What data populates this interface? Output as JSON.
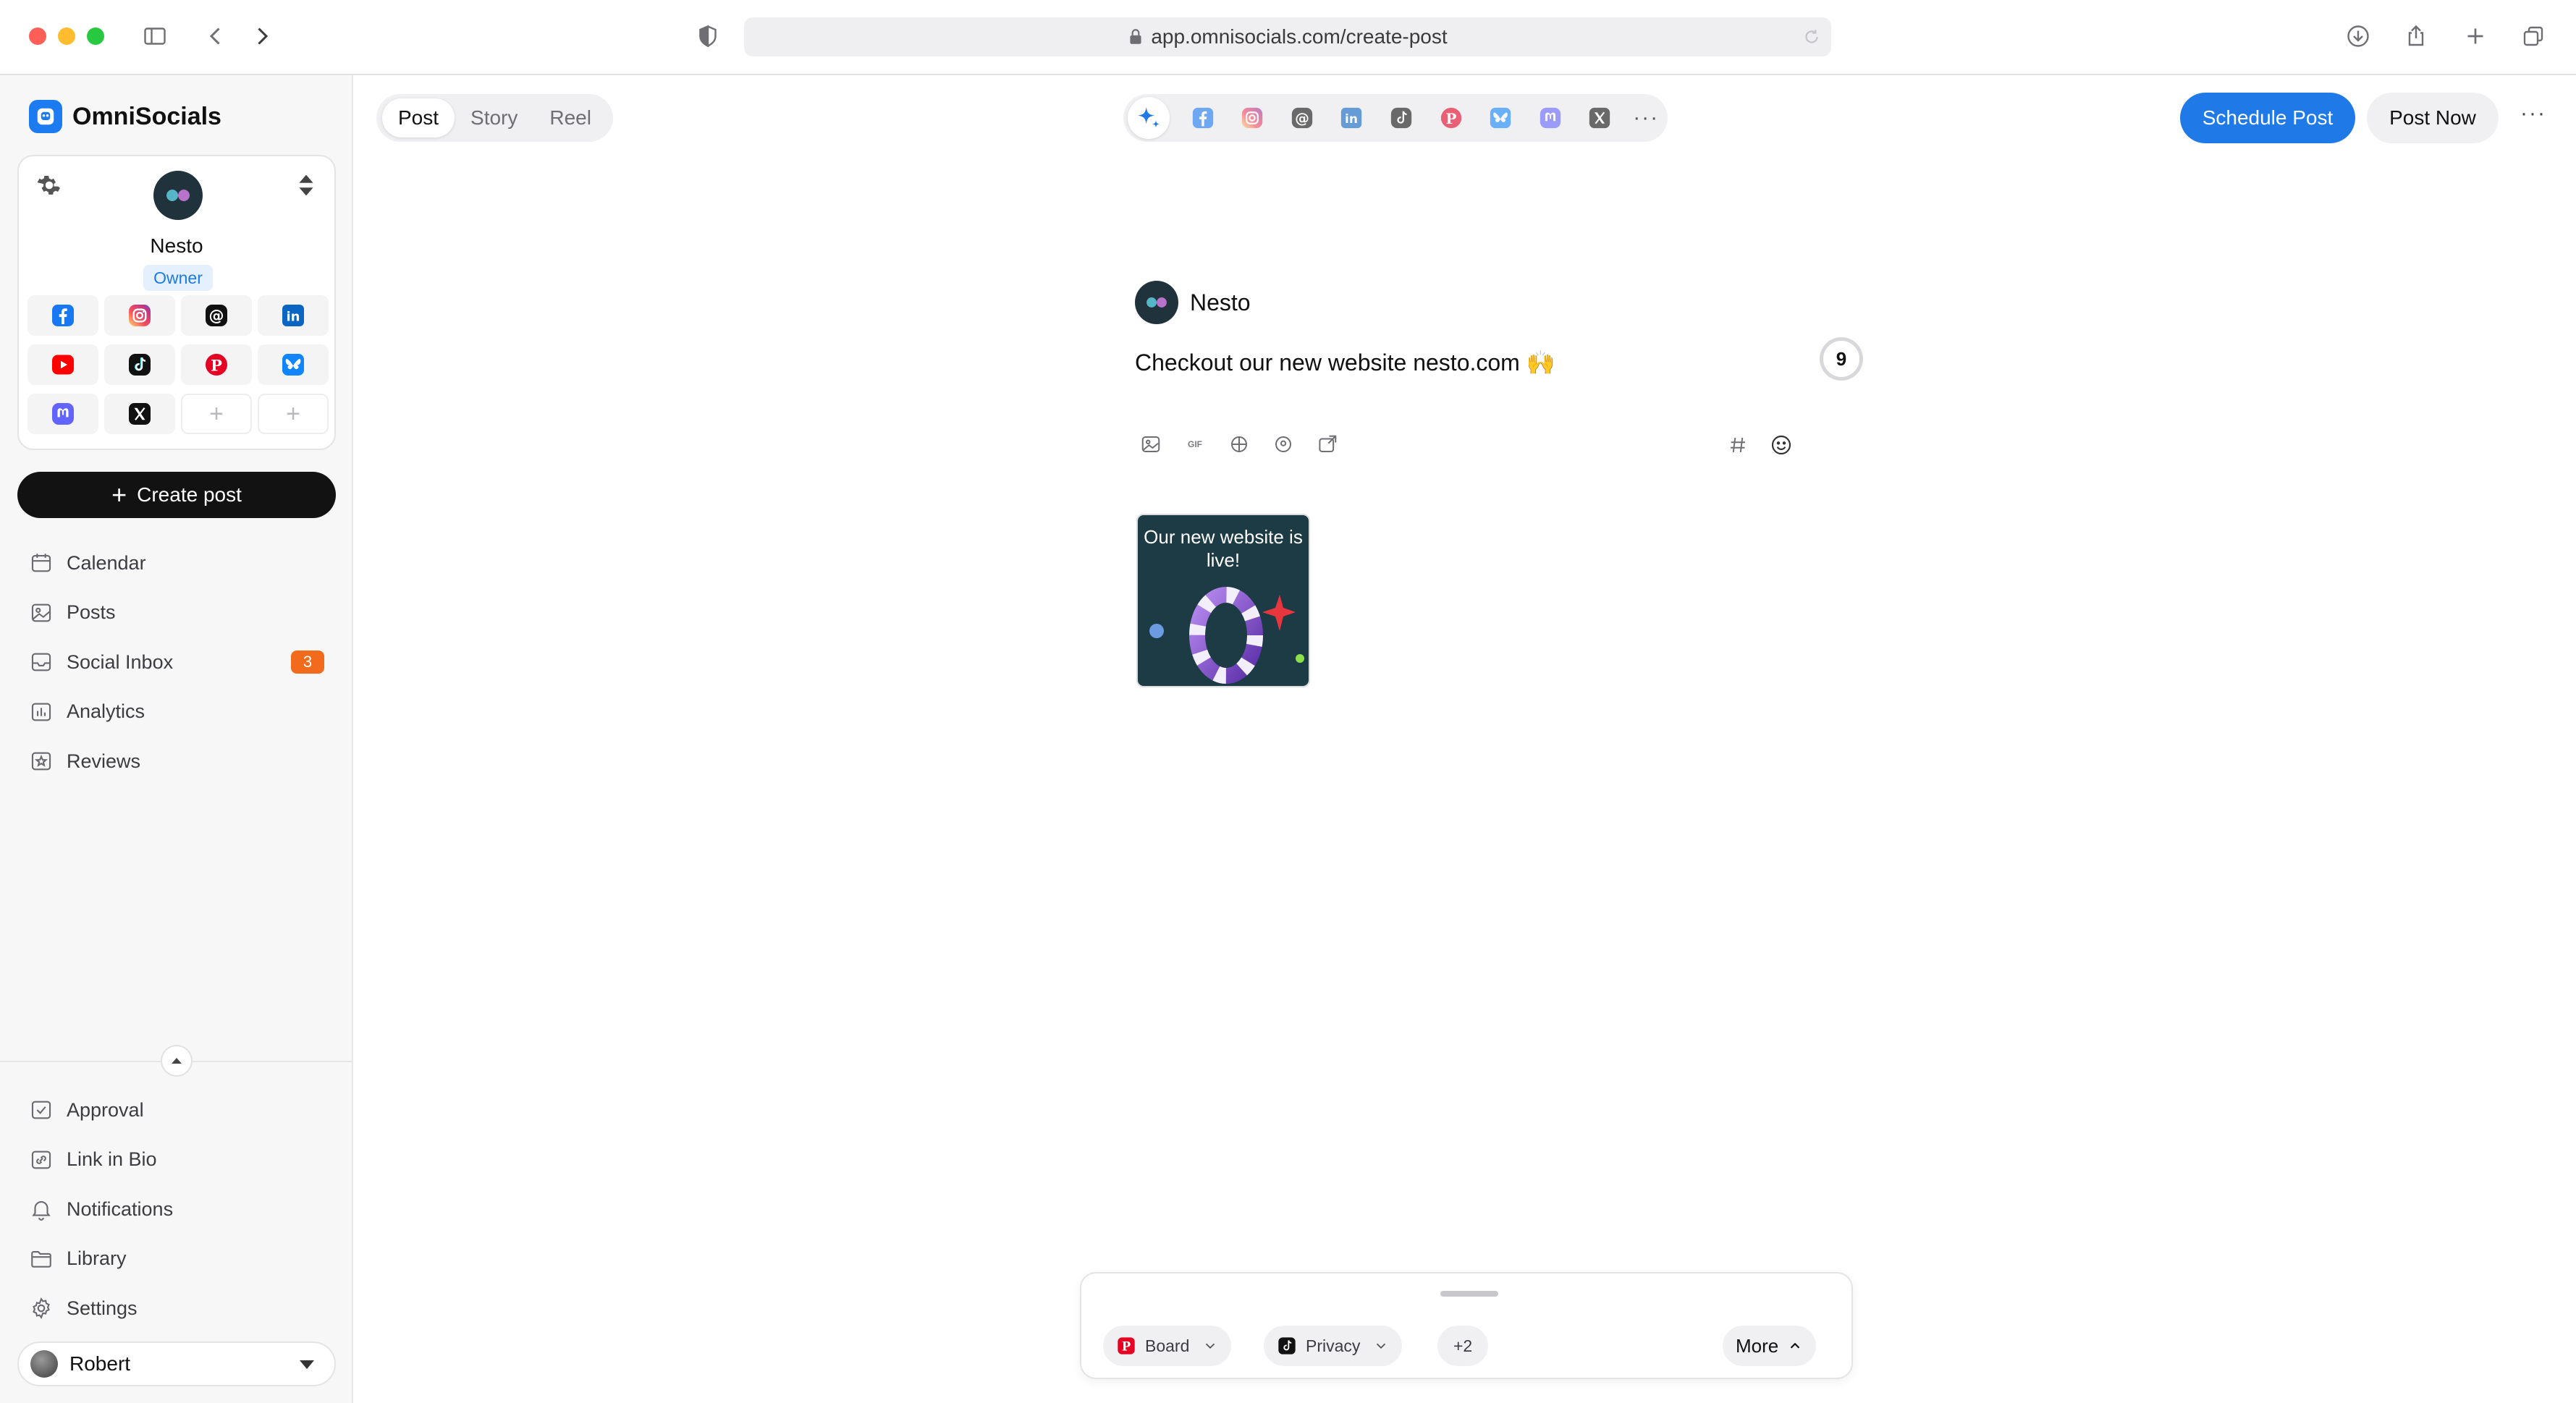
{
  "browser": {
    "url": "app.omnisocials.com/create-post"
  },
  "brand": {
    "name": "OmniSocials",
    "accent": "#1d7bf2"
  },
  "account": {
    "name": "Nesto",
    "role": "Owner",
    "networks": [
      "facebook",
      "instagram",
      "threads",
      "linkedin",
      "youtube",
      "tiktok",
      "pinterest",
      "bluesky",
      "mastodon",
      "x",
      "add",
      "add"
    ]
  },
  "sidebar": {
    "create_label": "Create post",
    "items": [
      {
        "label": "Calendar",
        "icon": "calendar-icon"
      },
      {
        "label": "Posts",
        "icon": "image-icon"
      },
      {
        "label": "Social Inbox",
        "icon": "inbox-icon",
        "badge": "3"
      },
      {
        "label": "Analytics",
        "icon": "chart-icon"
      },
      {
        "label": "Reviews",
        "icon": "star-icon"
      }
    ],
    "bottom_items": [
      {
        "label": "Approval",
        "icon": "check-square-icon"
      },
      {
        "label": "Link in Bio",
        "icon": "link-icon"
      },
      {
        "label": "Notifications",
        "icon": "bell-icon"
      },
      {
        "label": "Library",
        "icon": "folder-icon"
      },
      {
        "label": "Settings",
        "icon": "gear-icon"
      }
    ],
    "user": "Robert"
  },
  "toolbar": {
    "tabs": [
      "Post",
      "Story",
      "Reel"
    ],
    "active_tab": "Post",
    "schedule_label": "Schedule Post",
    "post_now_label": "Post Now",
    "networks": [
      "facebook",
      "instagram",
      "threads",
      "linkedin",
      "tiktok",
      "pinterest",
      "bluesky",
      "mastodon",
      "x"
    ]
  },
  "composer": {
    "account_name": "Nesto",
    "text": "Checkout our new website nesto.com 🙌",
    "char_count": "9",
    "gif_label": "GIF",
    "media": {
      "caption": "Our new website is live!"
    }
  },
  "options": {
    "board_label": "Board",
    "privacy_label": "Privacy",
    "extra_count": "+2",
    "more_label": "More"
  }
}
